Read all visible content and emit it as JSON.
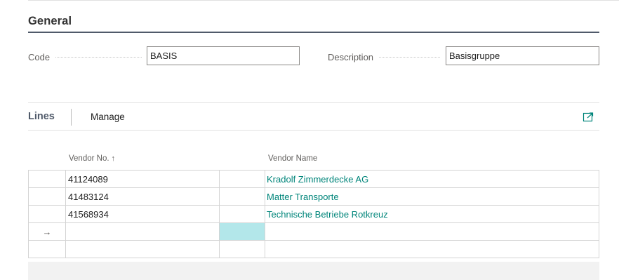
{
  "general": {
    "title": "General",
    "code_label": "Code",
    "code_value": "BASIS",
    "description_label": "Description",
    "description_value": "Basisgruppe"
  },
  "lines": {
    "title": "Lines",
    "manage_label": "Manage",
    "expand_icon": "open-in-new-window-icon",
    "columns": {
      "vendor_no": "Vendor No.",
      "vendor_no_sort": "↑",
      "vendor_name": "Vendor Name"
    },
    "rows": [
      {
        "vendor_no": "41124089",
        "vendor_name": "Kradolf Zimmerdecke AG"
      },
      {
        "vendor_no": "41483124",
        "vendor_name": "Matter Transporte"
      },
      {
        "vendor_no": "41568934",
        "vendor_name": "Technische Betriebe Rotkreuz"
      }
    ],
    "new_row_indicator": "→"
  },
  "colors": {
    "section_rule": "#505a6a",
    "link": "#00857a",
    "active_cell": "#b3e7ea"
  }
}
